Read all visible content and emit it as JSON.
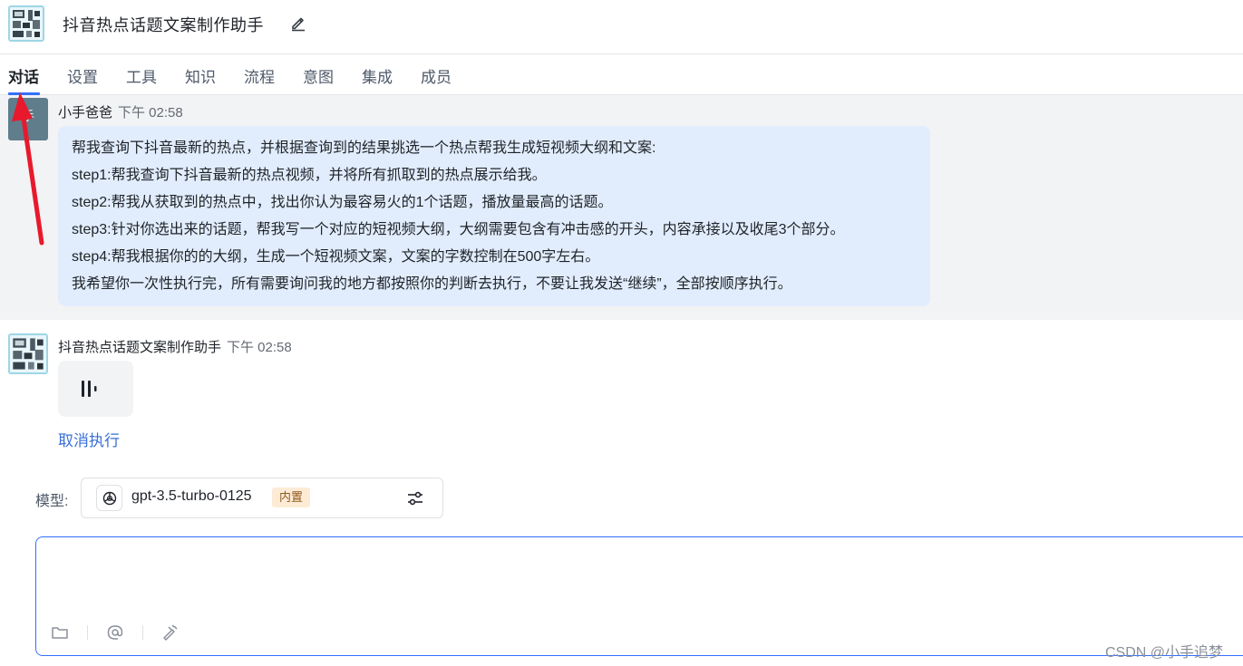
{
  "app": {
    "title": "抖音热点话题文案制作助手",
    "avatar_icon": "app-avatar-icon",
    "edit_icon": "pencil-icon"
  },
  "tabs": [
    {
      "label": "对话",
      "active": true
    },
    {
      "label": "设置",
      "active": false
    },
    {
      "label": "工具",
      "active": false
    },
    {
      "label": "知识",
      "active": false
    },
    {
      "label": "流程",
      "active": false
    },
    {
      "label": "意图",
      "active": false
    },
    {
      "label": "集成",
      "active": false
    },
    {
      "label": "成员",
      "active": false
    }
  ],
  "user_message": {
    "sender": "小手爸爸",
    "time": "下午 02:58",
    "avatar_text": "手",
    "lines": [
      "帮我查询下抖音最新的热点，并根据查询到的结果挑选一个热点帮我生成短视频大纲和文案:",
      "step1:帮我查询下抖音最新的热点视频，并将所有抓取到的热点展示给我。",
      "step2:帮我从获取到的热点中，找出你认为最容易火的1个话题，播放量最高的话题。",
      "step3:针对你选出来的话题，帮我写一个对应的短视频大纲，大纲需要包含有冲击感的开头，内容承接以及收尾3个部分。",
      "step4:帮我根据你的的大纲，生成一个短视频文案，文案的字数控制在500字左右。",
      "我希望你一次性执行完，所有需要询问我的地方都按照你的判断去执行，不要让我发送“继续”，全部按顺序执行。"
    ]
  },
  "bot_message": {
    "sender": "抖音热点话题文案制作助手",
    "time": "下午 02:58",
    "status_icon": "loading-audio-icon",
    "cancel_label": "取消执行"
  },
  "model": {
    "label": "模型:",
    "name": "gpt-3.5-turbo-0125",
    "badge": "内置",
    "icon": "openai-icon",
    "settings_icon": "sliders-icon"
  },
  "input": {
    "value": "",
    "tools": [
      "folder-icon",
      "at-icon",
      "magic-wand-icon"
    ]
  },
  "watermark": "CSDN @小手追梦",
  "colors": {
    "accent": "#3370ff",
    "user_bubble": "#e1edfc",
    "annotation_arrow": "#e8192c"
  }
}
